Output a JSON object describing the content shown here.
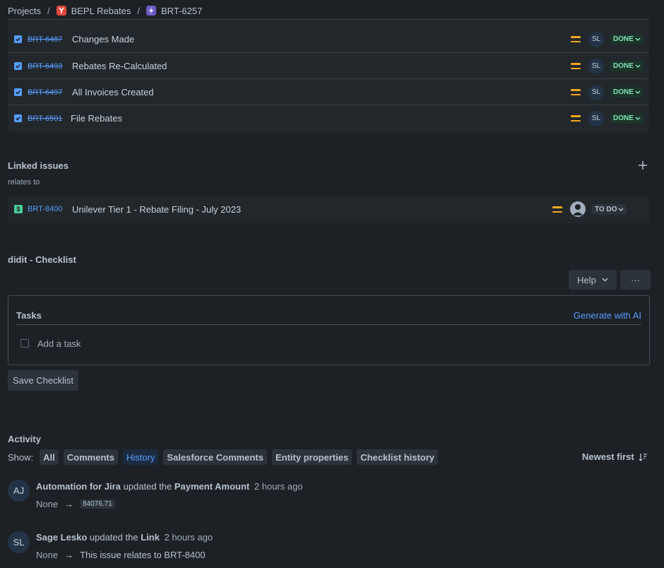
{
  "breadcrumb": {
    "projects": "Projects",
    "sep": "/",
    "project": "BEPL Rebates",
    "issue": "BRT-6257"
  },
  "child_issues": [
    {
      "key": "BRT-6487",
      "summary": "Changes Made",
      "assignee": "SL",
      "status": "DONE"
    },
    {
      "key": "BRT-6493",
      "summary": "Rebates Re-Calculated",
      "assignee": "SL",
      "status": "DONE"
    },
    {
      "key": "BRT-6497",
      "summary": "All Invoices Created",
      "assignee": "SL",
      "status": "DONE"
    },
    {
      "key": "BRT-6501",
      "summary": "File Rebates",
      "assignee": "SL",
      "status": "DONE"
    }
  ],
  "linked_issues": {
    "title": "Linked issues",
    "relation": "relates to",
    "item": {
      "key": "BRT-8400",
      "summary": "Unilever Tier 1 - Rebate Filing - July 2023",
      "status": "TO DO"
    }
  },
  "checklist": {
    "title": "didit - Checklist",
    "help_label": "Help",
    "more_label": "···",
    "tasks_label": "Tasks",
    "generate_label": "Generate with AI",
    "add_task_placeholder": "Add a task",
    "save_label": "Save Checklist"
  },
  "activity": {
    "title": "Activity",
    "show_label": "Show:",
    "filters": [
      "All",
      "Comments",
      "History",
      "Salesforce Comments",
      "Entity properties",
      "Checklist history"
    ],
    "active_filter": "History",
    "sort_label": "Newest first",
    "entries": [
      {
        "initials": "AJ",
        "actor": "Automation for Jira",
        "verb": "updated the",
        "field": "Payment Amount",
        "time": "2 hours ago",
        "from": "None",
        "arrow": "→",
        "to": "84076.71"
      },
      {
        "initials": "SL",
        "actor": "Sage Lesko",
        "verb": "updated the",
        "field": "Link",
        "time": "2 hours ago",
        "from": "None",
        "arrow": "→",
        "to": "This issue relates to BRT-8400"
      }
    ]
  }
}
